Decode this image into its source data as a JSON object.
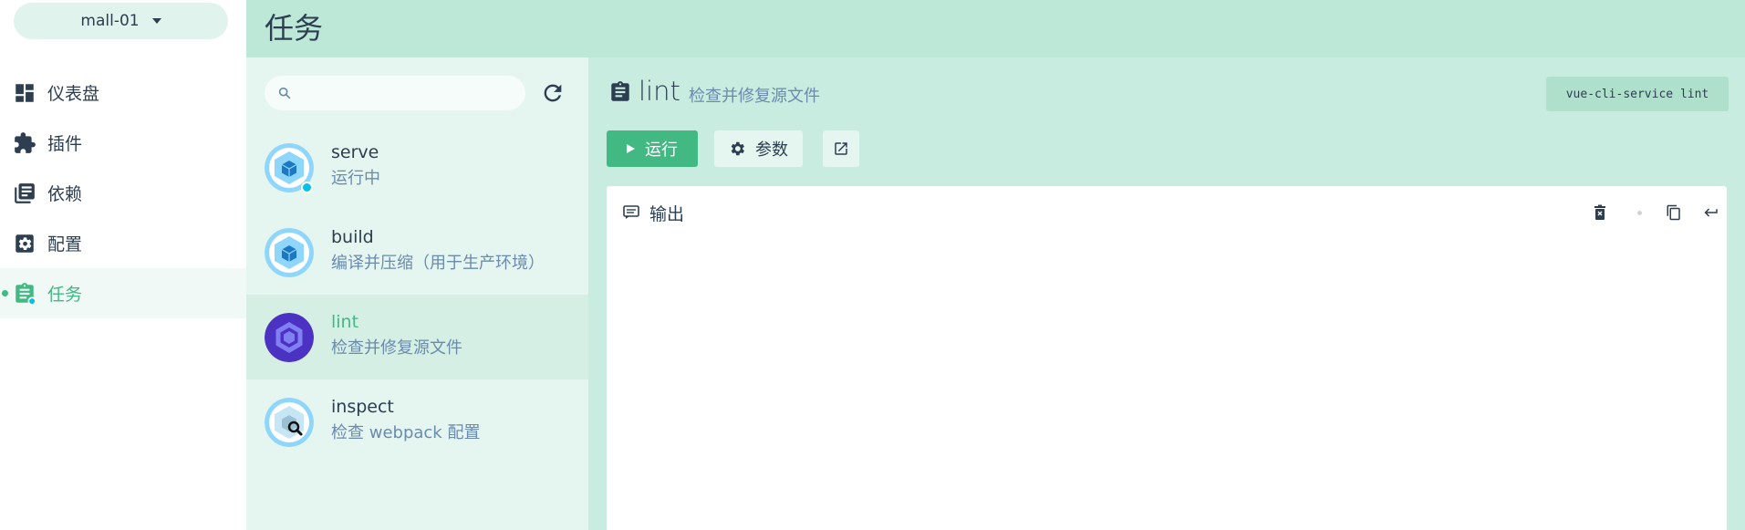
{
  "project": {
    "name": "mall-01"
  },
  "nav": {
    "items": [
      {
        "label": "仪表盘",
        "icon": "dashboard-icon"
      },
      {
        "label": "插件",
        "icon": "puzzle-icon"
      },
      {
        "label": "依赖",
        "icon": "library-books-icon"
      },
      {
        "label": "配置",
        "icon": "settings-box-icon"
      },
      {
        "label": "任务",
        "icon": "clipboard-icon",
        "active": true
      }
    ]
  },
  "header": {
    "title": "任务"
  },
  "search": {
    "placeholder": "",
    "value": ""
  },
  "tasks": [
    {
      "name": "serve",
      "description": "运行中",
      "status": "running",
      "icon": "webpack-icon"
    },
    {
      "name": "build",
      "description": "编译并压缩（用于生产环境）",
      "icon": "webpack-icon"
    },
    {
      "name": "lint",
      "description": "检查并修复源文件",
      "icon": "eslint-icon",
      "selected": true
    },
    {
      "name": "inspect",
      "description": "检查 webpack 配置",
      "icon": "webpack-inspect-icon"
    }
  ],
  "detail": {
    "name": "lint",
    "description": "检查并修复源文件",
    "command": "vue-cli-service lint",
    "run_label": "运行",
    "params_label": "参数",
    "output_title": "输出"
  },
  "colors": {
    "accent": "#42b983",
    "header_bg": "#bde8d8",
    "tasklist_bg": "#e5f5ef",
    "detail_bg": "#c8ece0",
    "running_dot": "#03c2e6"
  }
}
